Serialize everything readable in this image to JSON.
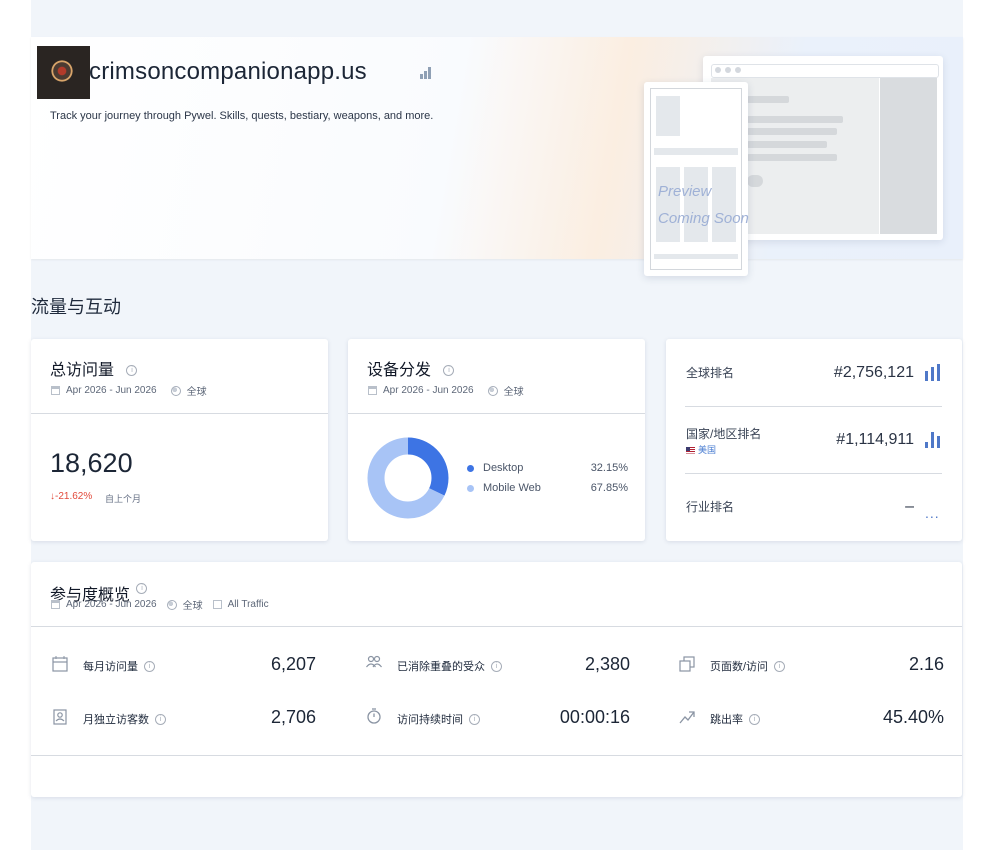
{
  "header": {
    "site_name": "crimsoncompanionapp.us",
    "description": "Track your journey through Pywel. Skills, quests, bestiary, weapons, and more.",
    "preview_text_line1": "Preview",
    "preview_text_line2": "Coming Soon"
  },
  "section_title": "流量与互动",
  "visits_card": {
    "title": "总访问量",
    "date_range": "Apr 2026 - Jun 2026",
    "region": "全球",
    "value": "18,620",
    "change": "↓-21.62%",
    "change_note": "自上个月"
  },
  "device_card": {
    "title": "设备分发",
    "date_range": "Apr 2026 - Jun 2026",
    "region": "全球",
    "chart_data": {
      "type": "pie",
      "categories": [
        "Desktop",
        "Mobile Web"
      ],
      "values": [
        32.15,
        67.85
      ],
      "labels": [
        "32.15%",
        "67.85%"
      ],
      "colors": [
        "#3d74e4",
        "#a8c4f6"
      ]
    }
  },
  "rank_card": {
    "global_label": "全球排名",
    "global_value": "#2,756,121",
    "country_label": "国家/地区排名",
    "country_value": "#1,114,911",
    "country_name": "美国",
    "industry_label": "行业排名",
    "industry_value": "–",
    "more": "..."
  },
  "engagement": {
    "title": "参与度概览",
    "date_range": "Apr 2026 - Jun 2026",
    "region": "全球",
    "traffic": "All Traffic",
    "metrics": [
      {
        "label": "每月访问量",
        "value": "6,207"
      },
      {
        "label": "已消除重叠的受众",
        "value": "2,380"
      },
      {
        "label": "页面数/访问",
        "value": "2.16"
      },
      {
        "label": "月独立访客数",
        "value": "2,706"
      },
      {
        "label": "访问持续时间",
        "value": "00:00:16"
      },
      {
        "label": "跳出率",
        "value": "45.40%"
      }
    ]
  },
  "colors": {
    "accent": "#3d74e4",
    "accent_light": "#a8c4f6",
    "negative": "#e24a3b",
    "page_bg": "#f1f5fa"
  }
}
